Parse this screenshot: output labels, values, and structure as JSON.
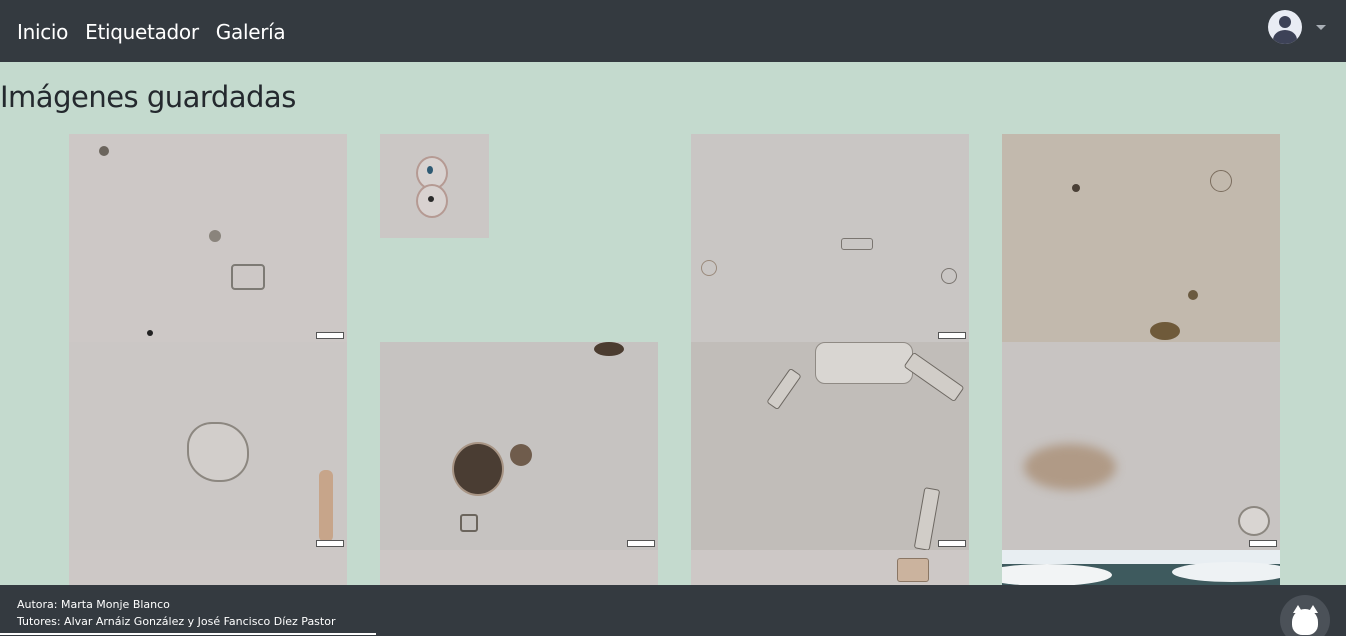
{
  "navbar": {
    "links": [
      {
        "label": "Inicio"
      },
      {
        "label": "Etiquetador"
      },
      {
        "label": "Galería"
      }
    ],
    "user_icon": "user-avatar-icon",
    "dropdown_icon": "caret-down-icon"
  },
  "page": {
    "title": "Imágenes guardadas"
  },
  "gallery": {
    "images": [
      {
        "type": "microscopy",
        "tone": "#cdc8c6"
      },
      {
        "type": "microscopy",
        "tone": "#cbc7c5"
      },
      {
        "type": "microscopy",
        "tone": "#c9c6c4"
      },
      {
        "type": "microscopy",
        "tone": "#c2b9ad"
      },
      {
        "type": "microscopy",
        "tone": "#cac6c4"
      },
      {
        "type": "microscopy",
        "tone": "#c6c3c1"
      },
      {
        "type": "microscopy",
        "tone": "#c1bdb9"
      },
      {
        "type": "microscopy",
        "tone": "#c8c4c2"
      },
      {
        "type": "microscopy",
        "tone": "#cdc8c6"
      },
      {
        "type": "microscopy",
        "tone": "#cdc8c6"
      },
      {
        "type": "microscopy",
        "tone": "#cdc8c6"
      },
      {
        "type": "landscape",
        "tone": "#e8eef2"
      }
    ]
  },
  "footer": {
    "author": "Autora: Marta Monje Blanco",
    "tutors": "Tutores: Alvar Arnáiz González y José Fancisco Díez Pastor",
    "github_icon": "github-icon"
  },
  "colors": {
    "navbar": "#343a40",
    "background": "#c4dace",
    "text": "#24292e"
  }
}
